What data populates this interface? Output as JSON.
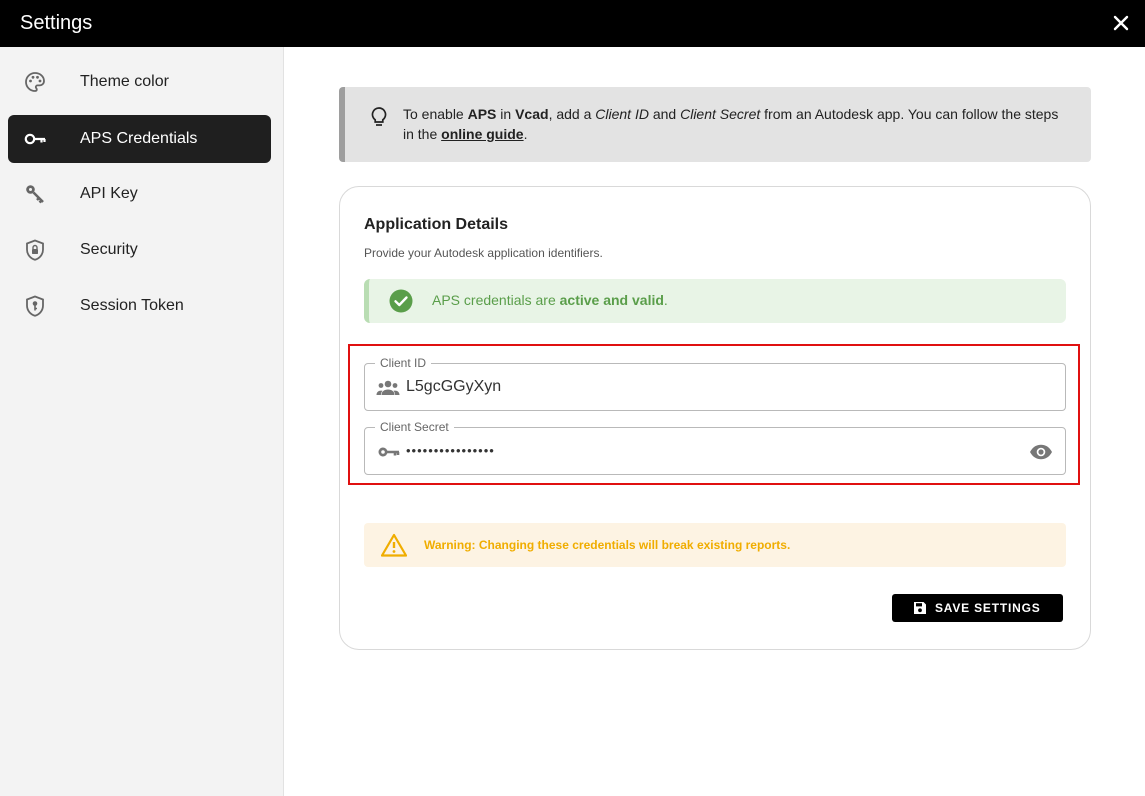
{
  "window": {
    "title": "Settings"
  },
  "sidebar": {
    "items": [
      {
        "label": "Theme color",
        "icon": "palette-icon",
        "active": false
      },
      {
        "label": "APS Credentials",
        "icon": "key-icon",
        "active": true
      },
      {
        "label": "API Key",
        "icon": "key-icon",
        "active": false
      },
      {
        "label": "Security",
        "icon": "shield-lock-icon",
        "active": false
      },
      {
        "label": "Session Token",
        "icon": "shield-key-icon",
        "active": false
      }
    ]
  },
  "info": {
    "t1": "To enable ",
    "aps": "APS",
    "t2": " in ",
    "vcad": "Vcad",
    "t3": ", add a ",
    "client_id": "Client ID",
    "t4": " and ",
    "client_secret": "Client Secret",
    "t5": " from an Autodesk app. You can follow the steps in the ",
    "link": "online guide",
    "t6": "."
  },
  "details": {
    "title": "Application Details",
    "subtitle": "Provide your Autodesk application identifiers.",
    "status_prefix": "APS credentials are ",
    "status_strong": "active and valid",
    "status_suffix": ".",
    "client_id_label": "Client ID",
    "client_id_value": "L5gcGGyXyn",
    "client_secret_label": "Client Secret",
    "client_secret_value": "••••••••••••••••",
    "warning": "Warning: Changing these credentials will break existing reports.",
    "save_label": "SAVE SETTINGS"
  },
  "colors": {
    "accent": "#1f1f1f",
    "success": "#5a9e4a",
    "warning": "#f0ad00",
    "highlight": "#e01010"
  }
}
